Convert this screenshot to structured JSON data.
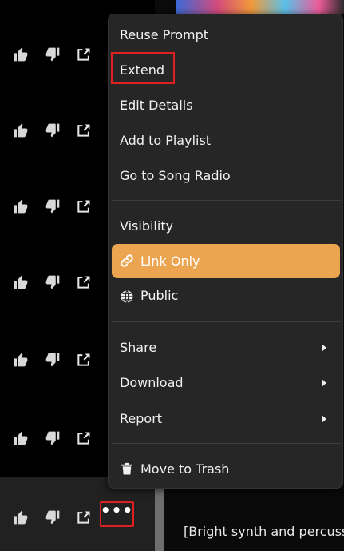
{
  "menu": {
    "items": [
      {
        "label": "Reuse Prompt"
      },
      {
        "label": "Extend"
      },
      {
        "label": "Edit Details"
      },
      {
        "label": "Add to Playlist"
      },
      {
        "label": "Go to Song Radio"
      }
    ],
    "visibility": {
      "heading": "Visibility",
      "link_only": "Link Only",
      "public": "Public"
    },
    "submenus": [
      {
        "label": "Share"
      },
      {
        "label": "Download"
      },
      {
        "label": "Report"
      }
    ],
    "trash": "Move to Trash"
  },
  "list": {
    "more_label": "•••"
  },
  "lyrics_snippet": "[Bright synth and percussi",
  "colors": {
    "accent": "#eba550",
    "highlight": "#e02020",
    "menu_bg": "#262626"
  },
  "icons": [
    "thumbs-up-icon",
    "thumbs-down-icon",
    "share-icon",
    "more-icon",
    "link-icon",
    "globe-icon",
    "trash-icon",
    "chevron-right-icon"
  ]
}
